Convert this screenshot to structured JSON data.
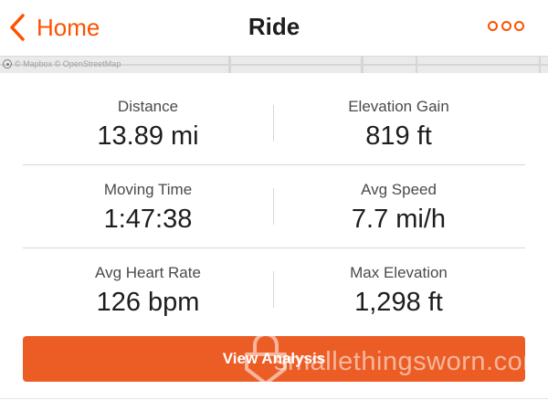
{
  "nav": {
    "back_label": "Home",
    "title": "Ride",
    "back_icon": "chevron-left-icon",
    "more_icon": "more-horizontal-icon"
  },
  "map": {
    "attribution": "© Mapbox © OpenStreetMap"
  },
  "stats": [
    {
      "label": "Distance",
      "value": "13.89 mi"
    },
    {
      "label": "Elevation Gain",
      "value": "819 ft"
    },
    {
      "label": "Moving Time",
      "value": "1:47:38"
    },
    {
      "label": "Avg Speed",
      "value": "7.7 mi/h"
    },
    {
      "label": "Avg Heart Rate",
      "value": "126 bpm"
    },
    {
      "label": "Max Elevation",
      "value": "1,298 ft"
    }
  ],
  "cta": {
    "label": "View Analysis"
  },
  "watermark": {
    "text": "smallethingsworn.com"
  },
  "colors": {
    "accent": "#fc5200",
    "button": "#ec5d26",
    "text": "#1d1d1f",
    "label": "#4a4a4f",
    "divider": "#d7d7da"
  }
}
